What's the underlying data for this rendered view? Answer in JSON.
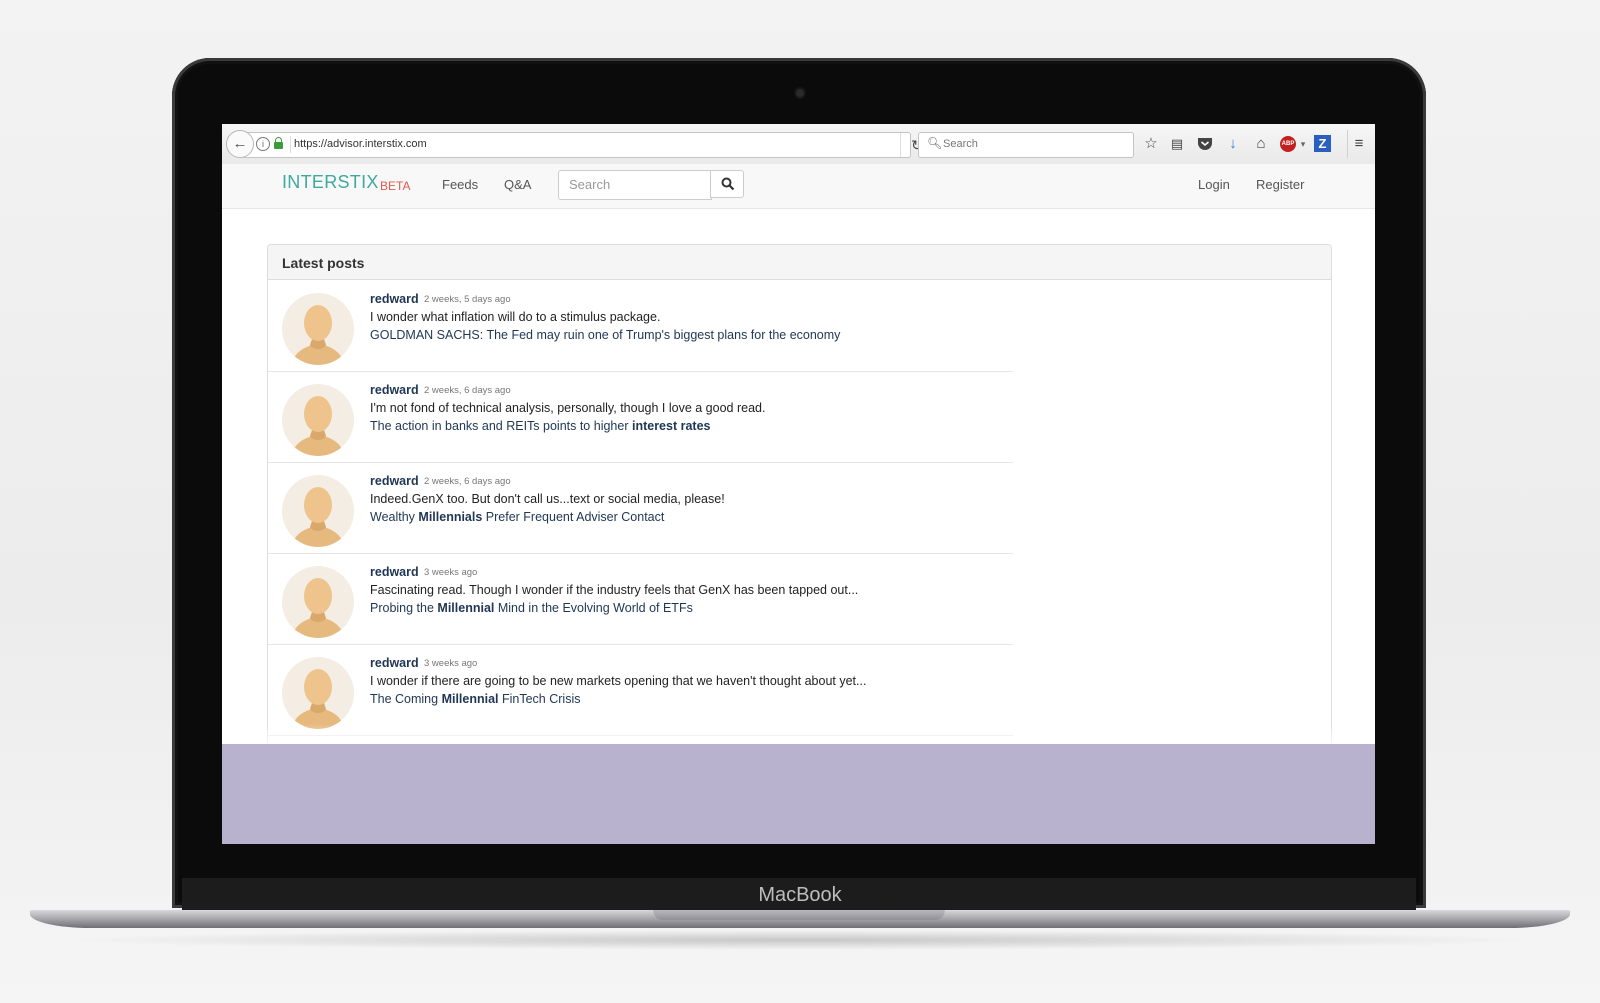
{
  "device": {
    "brand": "MacBook"
  },
  "browser": {
    "url": "https://advisor.interstix.com",
    "search_placeholder": "Search"
  },
  "site": {
    "logo": "INTERSTIX",
    "beta": "BETA",
    "nav": {
      "feeds": "Feeds",
      "qa": "Q&A"
    },
    "search_placeholder": "Search",
    "login": "Login",
    "register": "Register"
  },
  "panel": {
    "title": "Latest posts",
    "posts": [
      {
        "user": "redward",
        "time": "2 weeks, 5 days ago",
        "text": "I wonder what inflation will do to a stimulus package.",
        "link_before": "GOLDMAN SACHS: The Fed may ruin one of Trump's biggest plans for the economy",
        "link_bold": "",
        "link_after": ""
      },
      {
        "user": "redward",
        "time": "2 weeks, 6 days ago",
        "text": "I'm not fond of technical analysis, personally, though I love a good read.",
        "link_before": "The action in banks and REITs points to higher ",
        "link_bold": "interest rates",
        "link_after": ""
      },
      {
        "user": "redward",
        "time": "2 weeks, 6 days ago",
        "text": "Indeed.GenX too. But don't call us...text or social media, please!",
        "link_before": "Wealthy ",
        "link_bold": "Millennials",
        "link_after": " Prefer Frequent Adviser Contact"
      },
      {
        "user": "redward",
        "time": "3 weeks ago",
        "text": "Fascinating read. Though I wonder if the industry feels that GenX has been tapped out...",
        "link_before": "Probing the ",
        "link_bold": "Millennial",
        "link_after": " Mind in the Evolving World of ETFs"
      },
      {
        "user": "redward",
        "time": "3 weeks ago",
        "text": "I wonder if there are going to be new markets opening that we haven't thought about yet...",
        "link_before": "The Coming ",
        "link_bold": "Millennial",
        "link_after": " FinTech Crisis"
      }
    ]
  },
  "icons": {
    "back": "back-arrow-icon",
    "info": "info-icon",
    "lock": "lock-icon",
    "reload": "reload-icon",
    "search": "search-icon",
    "bookmark": "star-icon",
    "reader": "reading-list-icon",
    "pocket": "pocket-icon",
    "download": "download-icon",
    "home": "home-icon",
    "adblock": "adblock-icon",
    "zotero": "zotero-icon",
    "menu": "hamburger-menu-icon"
  }
}
